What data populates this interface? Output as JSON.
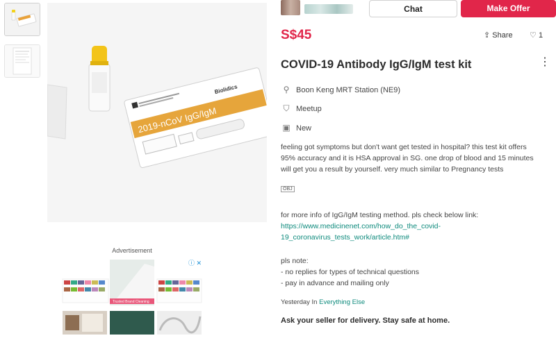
{
  "seller": {
    "chat_label": "Chat",
    "offer_label": "Make Offer"
  },
  "listing": {
    "price": "S$45",
    "share_label": "Share",
    "like_count": "1",
    "title": "COVID-19 Antibody IgG/IgM test kit",
    "location": "Boon Keng MRT Station (NE9)",
    "deal_method": "Meetup",
    "condition": "New",
    "description_1": "feeling got symptoms but don't want get tested in hospital? this test kit offers",
    "description_2": "95% accuracy and it is HSA approval in SG. one drop of blood and 15 minutes",
    "description_3": "will get you a result by yourself. very much similar to Pregnancy tests",
    "obj_marker": "OBJ",
    "more_info": "for more info of IgG/IgM testing method. pls check below link:",
    "link_1": "https://www.medicinenet.com/how_do_the_covid-",
    "link_2": "19_coronavirus_tests_work/article.htm#",
    "note_title": "pls note:",
    "note_1": "- no replies for types of technical questions",
    "note_2": "- pay in advance and mailing only",
    "posted_time": "Yesterday In",
    "category": "Everything Else",
    "delivery_notice": "Ask your seller for delivery. Stay safe at home."
  },
  "product_photo": {
    "box_brand": "Biolidics",
    "box_label": "2019-nCoV IgG/IgM"
  },
  "advertisement": {
    "label": "Advertisement",
    "banner_text": "Trusted Brand Cleaning"
  },
  "icons": {
    "location": "pin-icon",
    "deal": "tag-icon",
    "condition": "badge-icon",
    "share": "share-icon",
    "like": "heart-icon",
    "more": "kebab-icon"
  },
  "colors": {
    "accent": "#e1264a",
    "link": "#0d8a7c"
  }
}
